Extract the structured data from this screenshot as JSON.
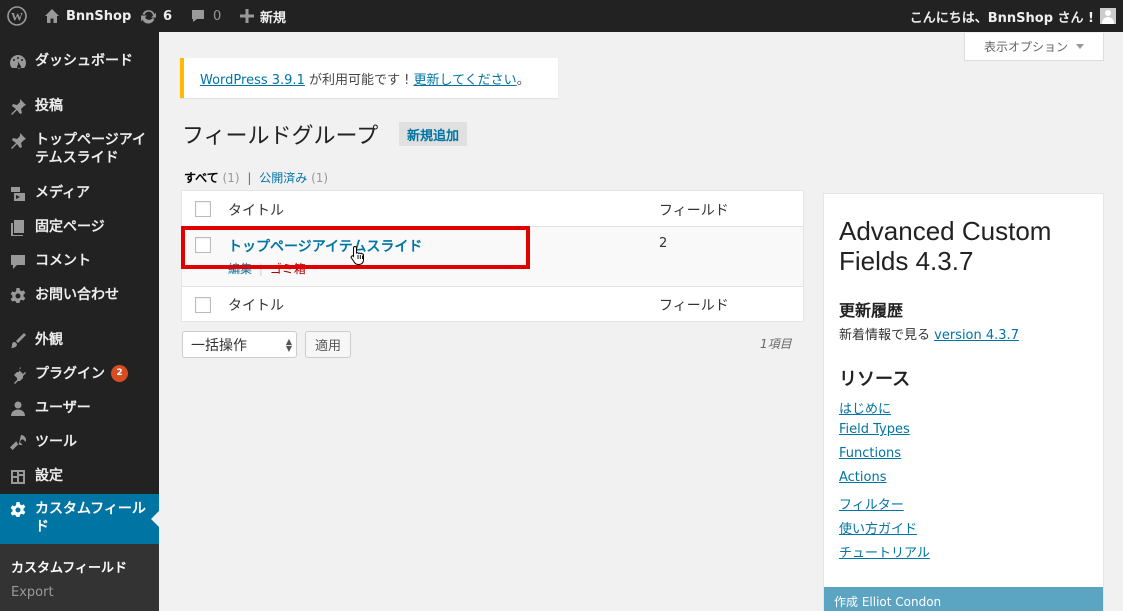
{
  "admin_bar": {
    "site_name": "BnnShop",
    "updates_count": "6",
    "comments_count": "0",
    "new_label": "新規",
    "greeting": "こんにちは、BnnShop さん !"
  },
  "sidebar": {
    "items": [
      {
        "label": "ダッシュボード",
        "icon": "dashboard-icon"
      },
      {
        "label": "投稿",
        "icon": "pin-icon"
      },
      {
        "label": "トップページアイテムスライド",
        "icon": "pin-icon"
      },
      {
        "label": "メディア",
        "icon": "media-icon"
      },
      {
        "label": "固定ページ",
        "icon": "page-icon"
      },
      {
        "label": "コメント",
        "icon": "comment-icon"
      },
      {
        "label": "お問い合わせ",
        "icon": "gear-icon"
      },
      {
        "label": "外観",
        "icon": "brush-icon"
      },
      {
        "label": "プラグイン",
        "icon": "plugin-icon",
        "badge": "2"
      },
      {
        "label": "ユーザー",
        "icon": "user-icon"
      },
      {
        "label": "ツール",
        "icon": "wrench-icon"
      },
      {
        "label": "設定",
        "icon": "settings-icon"
      },
      {
        "label": "カスタムフィールド",
        "icon": "gear-icon",
        "active": true
      }
    ],
    "submenu": [
      "カスタムフィールド",
      "Export"
    ]
  },
  "screen_options": {
    "label": "表示オプション"
  },
  "notice": {
    "link1": "WordPress 3.9.1",
    "text": " が利用可能です ! ",
    "link2": "更新してください",
    "tail": "。"
  },
  "page": {
    "title": "フィールドグループ",
    "add_new": "新規追加"
  },
  "filters": {
    "all": "すべて",
    "all_count": "(1)",
    "separator": "|",
    "published": "公開済み",
    "published_count": "(1)"
  },
  "table": {
    "col_title": "タイトル",
    "col_fields": "フィールド",
    "rows": [
      {
        "title": "トップページアイテムスライド",
        "fields": "2",
        "edit": "編集",
        "trash": "ゴミ箱"
      }
    ]
  },
  "bulk": {
    "select": "一括操作",
    "apply": "適用",
    "count": "1項目"
  },
  "acf": {
    "title": "Advanced Custom Fields 4.3.7",
    "changelog_heading": "更新履歴",
    "changelog_text": "新着情報で見る ",
    "changelog_link": "version 4.3.7",
    "resources_heading": "リソース",
    "resources": [
      "はじめに",
      "Field Types",
      "Functions",
      "Actions",
      "フィルター",
      "使い方ガイド",
      "チュートリアル"
    ],
    "footer": "作成 Elliot Condon"
  },
  "colors": {
    "admin_bg": "#222222",
    "active": "#0074a2",
    "notice_border": "#ffba00",
    "highlight": "#e00000",
    "badge": "#d54e21"
  }
}
